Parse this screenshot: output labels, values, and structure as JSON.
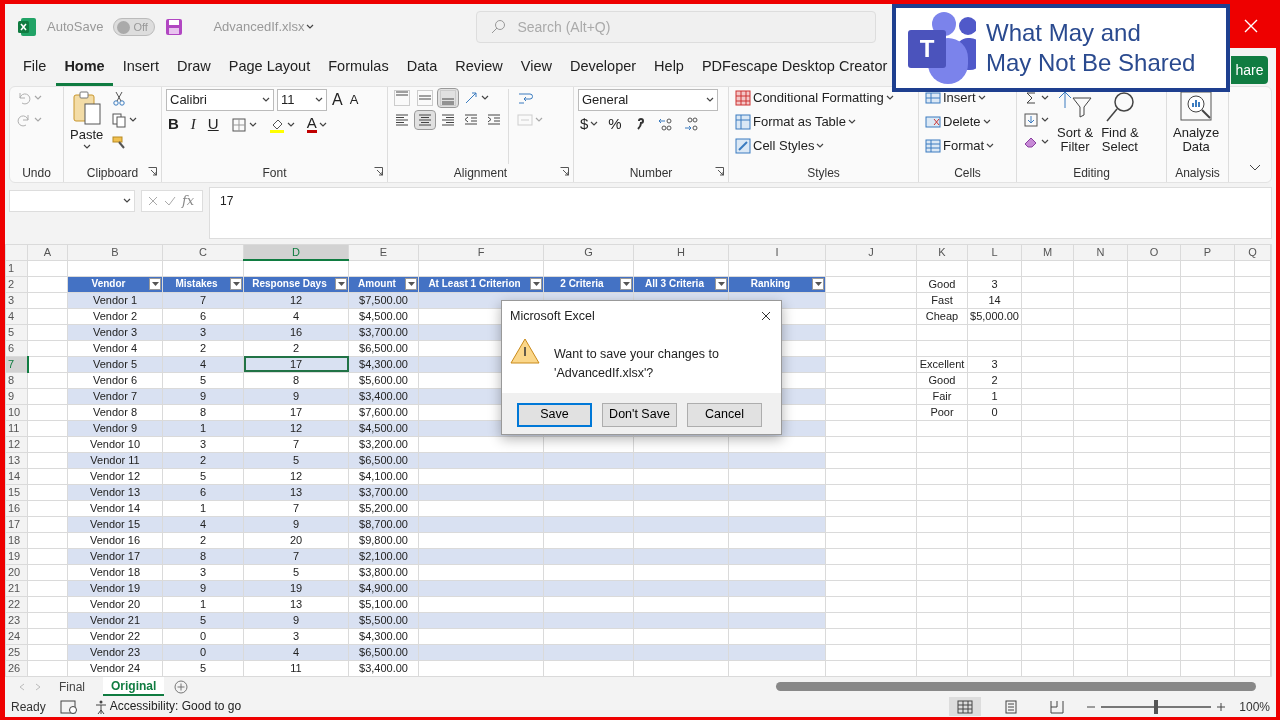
{
  "title_bar": {
    "autosave_label": "AutoSave",
    "autosave": {
      "on": false,
      "label": "Off"
    },
    "file_name": "AdvancedIf.xlsx",
    "search": {
      "placeholder": "Search (Alt+Q)"
    }
  },
  "overlay": {
    "logo_letter": "T",
    "title_lines": [
      "What May and",
      "May Not Be Shared"
    ]
  },
  "ribbon_tabs": [
    {
      "label": "File",
      "selected": false
    },
    {
      "label": "Home",
      "selected": true
    },
    {
      "label": "Insert",
      "selected": false
    },
    {
      "label": "Draw",
      "selected": false
    },
    {
      "label": "Page Layout",
      "selected": false
    },
    {
      "label": "Formulas",
      "selected": false
    },
    {
      "label": "Data",
      "selected": false
    },
    {
      "label": "Review",
      "selected": false
    },
    {
      "label": "View",
      "selected": false
    },
    {
      "label": "Developer",
      "selected": false
    },
    {
      "label": "Help",
      "selected": false
    },
    {
      "label": "PDFescape Desktop Creator",
      "selected": false
    }
  ],
  "share_button": {
    "label": "hare"
  },
  "ribbon": {
    "groups": [
      {
        "kind": "undo",
        "label": "Undo",
        "items": [
          {
            "kind": "undo",
            "disabled": true
          },
          {
            "kind": "redo",
            "disabled": true
          }
        ]
      },
      {
        "kind": "clipboard",
        "label": "Clipboard",
        "paste": "Paste"
      },
      {
        "kind": "font",
        "label": "Font",
        "font_name": "Calibri",
        "font_size": "11",
        "grow": "A",
        "shrink": "A",
        "bold": "B",
        "italic": "I",
        "underline": "U",
        "font_color": "A"
      },
      {
        "kind": "alignment",
        "label": "Alignment",
        "vertical": [
          {
            "kind": "top",
            "selected": false
          },
          {
            "kind": "middle",
            "selected": false
          },
          {
            "kind": "bottom",
            "selected": true
          }
        ],
        "horizontal": [
          {
            "kind": "left",
            "selected": false
          },
          {
            "kind": "center",
            "selected": true
          },
          {
            "kind": "right",
            "selected": false
          }
        ]
      },
      {
        "kind": "number",
        "label": "Number",
        "format": "General",
        "currency": "$",
        "percent": "%"
      },
      {
        "kind": "styles",
        "label": "Styles",
        "items": [
          "Conditional Formatting",
          "Format as Table",
          "Cell Styles"
        ]
      },
      {
        "kind": "cells",
        "label": "Cells",
        "items": [
          "Insert",
          "Delete",
          "Format"
        ]
      },
      {
        "kind": "editing",
        "label": "Editing",
        "items": [
          "Sort &",
          "Filter",
          "Find &",
          "Select"
        ]
      },
      {
        "kind": "analysis",
        "label": "Analysis",
        "items": [
          "Analyze",
          "Data"
        ]
      }
    ]
  },
  "formula_bar": {
    "function_label": "fx",
    "formula": "17"
  },
  "sheet": {
    "columns": [
      {
        "label": "A",
        "selected": false
      },
      {
        "label": "B",
        "selected": false
      },
      {
        "label": "C",
        "selected": false
      },
      {
        "label": "D",
        "selected": true
      },
      {
        "label": "E",
        "selected": false
      },
      {
        "label": "F",
        "selected": false
      },
      {
        "label": "G",
        "selected": false
      },
      {
        "label": "H",
        "selected": false
      },
      {
        "label": "I",
        "selected": false
      },
      {
        "label": "J",
        "selected": false
      },
      {
        "label": "K",
        "selected": false
      },
      {
        "label": "L",
        "selected": false
      },
      {
        "label": "M",
        "selected": false
      },
      {
        "label": "N",
        "selected": false
      },
      {
        "label": "O",
        "selected": false
      },
      {
        "label": "P",
        "selected": false
      },
      {
        "label": "Q",
        "selected": false
      }
    ],
    "row_headers": [
      {
        "label": "1",
        "selected": false
      },
      {
        "label": "2",
        "selected": false
      },
      {
        "label": "3",
        "selected": false
      },
      {
        "label": "4",
        "selected": false
      },
      {
        "label": "5",
        "selected": false
      },
      {
        "label": "6",
        "selected": false
      },
      {
        "label": "7",
        "selected": true
      },
      {
        "label": "8",
        "selected": false
      },
      {
        "label": "9",
        "selected": false
      },
      {
        "label": "10",
        "selected": false
      },
      {
        "label": "11",
        "selected": false
      },
      {
        "label": "12",
        "selected": false
      },
      {
        "label": "13",
        "selected": false
      },
      {
        "label": "14",
        "selected": false
      },
      {
        "label": "15",
        "selected": false
      },
      {
        "label": "16",
        "selected": false
      },
      {
        "label": "17",
        "selected": false
      },
      {
        "label": "18",
        "selected": false
      },
      {
        "label": "19",
        "selected": false
      },
      {
        "label": "20",
        "selected": false
      },
      {
        "label": "21",
        "selected": false
      },
      {
        "label": "22",
        "selected": false
      },
      {
        "label": "23",
        "selected": false
      },
      {
        "label": "24",
        "selected": false
      },
      {
        "label": "25",
        "selected": false
      },
      {
        "label": "26",
        "selected": false
      }
    ],
    "table": {
      "headers": [
        "Vendor",
        "Mistakes",
        "Response Days",
        "Amount",
        "At Least 1 Criterion",
        "2 Criteria",
        "All 3 Criteria",
        "Ranking"
      ],
      "rows": [
        [
          "Vendor 1",
          "7",
          "12",
          "$7,500.00"
        ],
        [
          "Vendor 2",
          "6",
          "4",
          "$4,500.00"
        ],
        [
          "Vendor 3",
          "3",
          "16",
          "$3,700.00"
        ],
        [
          "Vendor 4",
          "2",
          "2",
          "$6,500.00"
        ],
        [
          "Vendor 5",
          "4",
          "17",
          "$4,300.00"
        ],
        [
          "Vendor 6",
          "5",
          "8",
          "$5,600.00"
        ],
        [
          "Vendor 7",
          "9",
          "9",
          "$3,400.00"
        ],
        [
          "Vendor 8",
          "8",
          "17",
          "$7,600.00"
        ],
        [
          "Vendor 9",
          "1",
          "12",
          "$4,500.00"
        ],
        [
          "Vendor 10",
          "3",
          "7",
          "$3,200.00"
        ],
        [
          "Vendor 11",
          "2",
          "5",
          "$6,500.00"
        ],
        [
          "Vendor 12",
          "5",
          "12",
          "$4,100.00"
        ],
        [
          "Vendor 13",
          "6",
          "13",
          "$3,700.00"
        ],
        [
          "Vendor 14",
          "1",
          "7",
          "$5,200.00"
        ],
        [
          "Vendor 15",
          "4",
          "9",
          "$8,700.00"
        ],
        [
          "Vendor 16",
          "2",
          "20",
          "$9,800.00"
        ],
        [
          "Vendor 17",
          "8",
          "7",
          "$2,100.00"
        ],
        [
          "Vendor 18",
          "3",
          "5",
          "$3,800.00"
        ],
        [
          "Vendor 19",
          "9",
          "19",
          "$4,900.00"
        ],
        [
          "Vendor 20",
          "1",
          "13",
          "$5,100.00"
        ],
        [
          "Vendor 21",
          "5",
          "9",
          "$5,500.00"
        ],
        [
          "Vendor 22",
          "0",
          "3",
          "$4,300.00"
        ],
        [
          "Vendor 23",
          "0",
          "4",
          "$6,500.00"
        ],
        [
          "Vendor 24",
          "5",
          "11",
          "$3,400.00"
        ]
      ]
    },
    "criteria": [
      {
        "label": "Good",
        "value": "3"
      },
      {
        "label": "Fast",
        "value": "14"
      },
      {
        "label": "Cheap",
        "value": "$5,000.00"
      }
    ],
    "ranking": [
      {
        "label": "Excellent",
        "value": "3"
      },
      {
        "label": "Good",
        "value": "2"
      },
      {
        "label": "Fair",
        "value": "1"
      },
      {
        "label": "Poor",
        "value": "0"
      }
    ]
  },
  "dialog": {
    "title": "Microsoft Excel",
    "message": "Want to save your changes to 'AdvancedIf.xlsx'?",
    "buttons": [
      {
        "label": "Save",
        "default": true
      },
      {
        "label": "Don't Save",
        "default": false
      },
      {
        "label": "Cancel",
        "default": false
      }
    ]
  },
  "sheet_tabs": [
    {
      "label": "Final",
      "selected": false
    },
    {
      "label": "Original",
      "selected": true
    }
  ],
  "status_bar": {
    "ready": "Ready",
    "accessibility": "Accessibility: Good to go",
    "views": [
      {
        "kind": "normal",
        "selected": true
      },
      {
        "kind": "page_layout",
        "selected": false
      },
      {
        "kind": "page_break",
        "selected": false
      }
    ],
    "zoom": {
      "level": 0.5,
      "label": "100%"
    }
  }
}
